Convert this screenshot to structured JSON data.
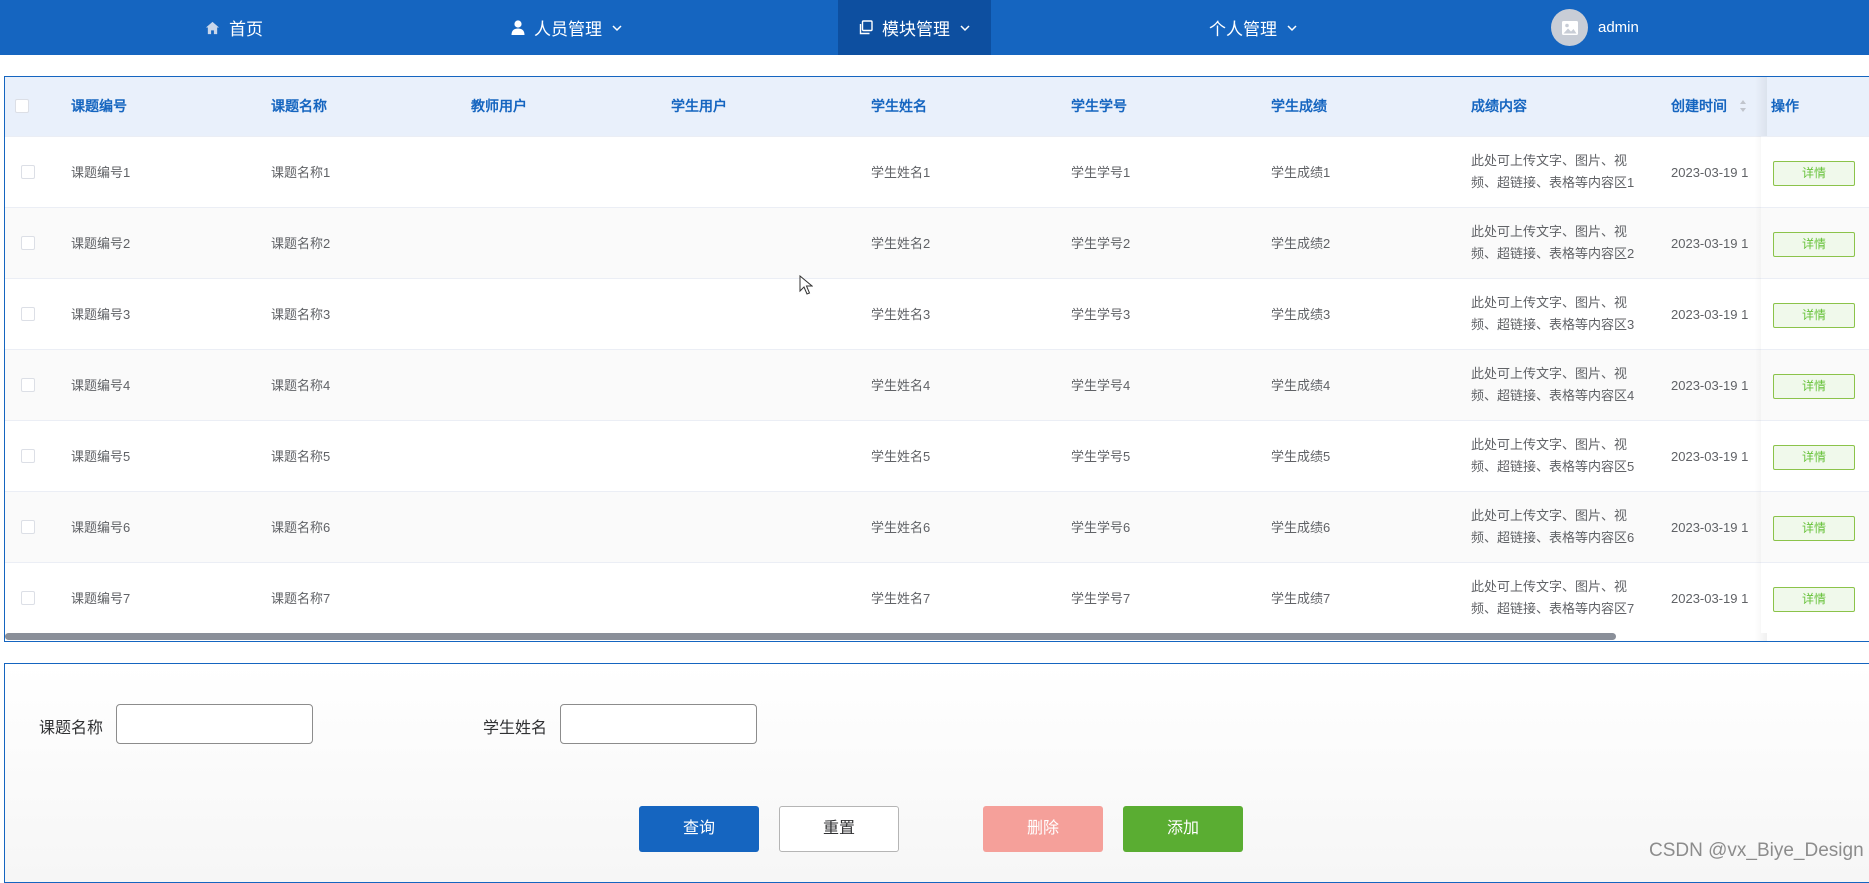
{
  "nav": {
    "home": "首页",
    "people": "人员管理",
    "modules": "模块管理",
    "personal": "个人管理",
    "user": "admin"
  },
  "table": {
    "headers": [
      "课题编号",
      "课题名称",
      "教师用户",
      "学生用户",
      "学生姓名",
      "学生学号",
      "学生成绩",
      "成绩内容",
      "创建时间",
      "操作"
    ],
    "rows": [
      {
        "code": "课题编号1",
        "name": "课题名称1",
        "teacher": "",
        "student_user": "",
        "student_name": "学生姓名1",
        "student_no": "学生学号1",
        "score": "学生成绩1",
        "content": "此处可上传文字、图片、视频、超链接、表格等内容区1",
        "created": "2023-03-19 1",
        "action": "详情"
      },
      {
        "code": "课题编号2",
        "name": "课题名称2",
        "teacher": "",
        "student_user": "",
        "student_name": "学生姓名2",
        "student_no": "学生学号2",
        "score": "学生成绩2",
        "content": "此处可上传文字、图片、视频、超链接、表格等内容区2",
        "created": "2023-03-19 1",
        "action": "详情"
      },
      {
        "code": "课题编号3",
        "name": "课题名称3",
        "teacher": "",
        "student_user": "",
        "student_name": "学生姓名3",
        "student_no": "学生学号3",
        "score": "学生成绩3",
        "content": "此处可上传文字、图片、视频、超链接、表格等内容区3",
        "created": "2023-03-19 1",
        "action": "详情"
      },
      {
        "code": "课题编号4",
        "name": "课题名称4",
        "teacher": "",
        "student_user": "",
        "student_name": "学生姓名4",
        "student_no": "学生学号4",
        "score": "学生成绩4",
        "content": "此处可上传文字、图片、视频、超链接、表格等内容区4",
        "created": "2023-03-19 1",
        "action": "详情"
      },
      {
        "code": "课题编号5",
        "name": "课题名称5",
        "teacher": "",
        "student_user": "",
        "student_name": "学生姓名5",
        "student_no": "学生学号5",
        "score": "学生成绩5",
        "content": "此处可上传文字、图片、视频、超链接、表格等内容区5",
        "created": "2023-03-19 1",
        "action": "详情"
      },
      {
        "code": "课题编号6",
        "name": "课题名称6",
        "teacher": "",
        "student_user": "",
        "student_name": "学生姓名6",
        "student_no": "学生学号6",
        "score": "学生成绩6",
        "content": "此处可上传文字、图片、视频、超链接、表格等内容区6",
        "created": "2023-03-19 1",
        "action": "详情"
      },
      {
        "code": "课题编号7",
        "name": "课题名称7",
        "teacher": "",
        "student_user": "",
        "student_name": "学生姓名7",
        "student_no": "学生学号7",
        "score": "学生成绩7",
        "content": "此处可上传文字、图片、视频、超链接、表格等内容区7",
        "created": "2023-03-19 1",
        "action": "详情"
      }
    ]
  },
  "search": {
    "label_topic": "课题名称",
    "label_student": "学生姓名",
    "topic_value": "",
    "student_value": "",
    "query": "查询",
    "reset": "重置",
    "delete": "删除",
    "add": "添加"
  },
  "watermark": "CSDN @vx_Biye_Design"
}
